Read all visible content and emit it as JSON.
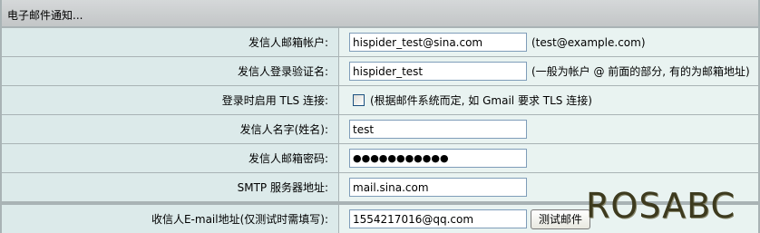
{
  "section": {
    "title": "电子邮件通知..."
  },
  "fields": {
    "sender_account": {
      "label": "发信人邮箱帐户:",
      "value": "hispider_test@sina.com",
      "hint": "(test@example.com)"
    },
    "login_name": {
      "label": "发信人登录验证名:",
      "value": "hispider_test",
      "hint": "(一般为帐户 @ 前面的部分, 有的为邮箱地址)"
    },
    "tls": {
      "label": "登录时启用 TLS 连接:",
      "checked": false,
      "hint": "(根据邮件系统而定, 如 Gmail 要求 TLS 连接)"
    },
    "sender_name": {
      "label": "发信人名字(姓名):",
      "value": "test"
    },
    "password": {
      "label": "发信人邮箱密码:",
      "masked_value": "●●●●●●●●●●●"
    },
    "smtp_server": {
      "label": "SMTP 服务器地址:",
      "value": "mail.sina.com"
    },
    "recipient": {
      "label": "收信人E-mail地址(仅测试时需填写):",
      "value": "1554217016@qq.com",
      "button_label": "测试邮件"
    }
  },
  "watermark": {
    "text": "ROSABC"
  },
  "colors": {
    "label_bg": "#dceaea",
    "value_bg": "#e9f3f1",
    "title_bg": "#c9cccd",
    "border": "#a9b3b5"
  }
}
